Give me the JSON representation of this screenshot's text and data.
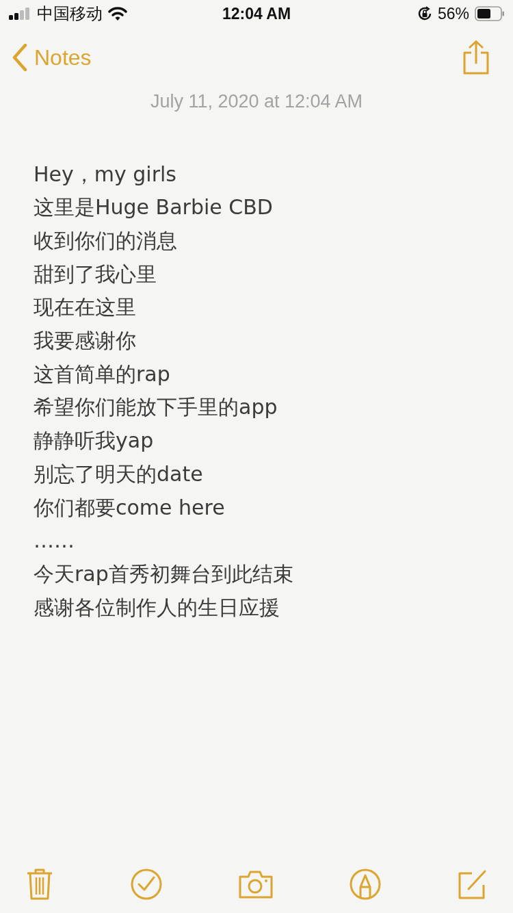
{
  "status_bar": {
    "carrier": "中国移动",
    "time": "12:04 AM",
    "battery": "56%"
  },
  "nav": {
    "back": "Notes"
  },
  "note": {
    "date": "July 11, 2020 at 12:04 AM",
    "lines": [
      "Hey，my girls",
      "这里是Huge Barbie CBD",
      "收到你们的消息",
      "甜到了我心里",
      "现在在这里",
      "我要感谢你",
      "这首简单的rap",
      "希望你们能放下手里的app",
      "静静听我yap",
      "别忘了明天的date",
      "你们都要come here",
      "……",
      "今天rap首秀初舞台到此结束",
      "感谢各位制作人的生日应援"
    ]
  }
}
